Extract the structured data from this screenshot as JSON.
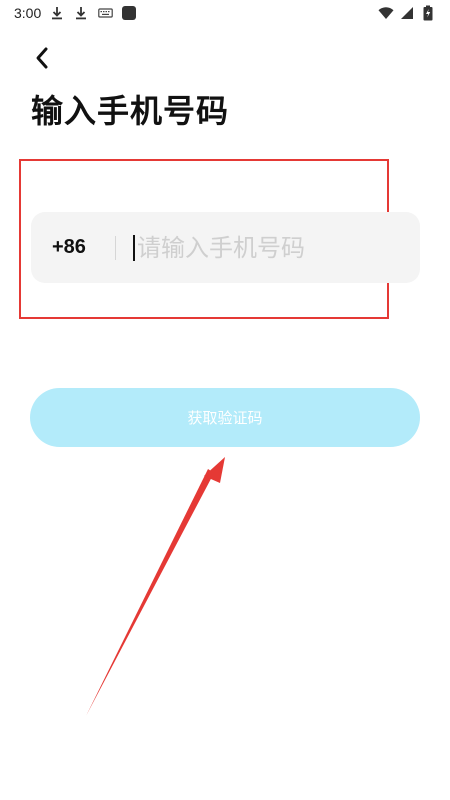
{
  "status_bar": {
    "time": "3:00",
    "left_icons": [
      "download-icon",
      "download-icon",
      "keyboard-icon",
      "app-icon"
    ],
    "right_icons": [
      "wifi-icon",
      "signal-icon",
      "battery-charging-icon"
    ]
  },
  "header": {
    "back_icon": "chevron-left-icon",
    "title": "输入手机号码"
  },
  "phone_input": {
    "country_code": "+86",
    "value": "",
    "placeholder": "请输入手机号码"
  },
  "actions": {
    "get_code_label": "获取验证码"
  },
  "colors": {
    "highlight": "#e53935",
    "button_bg": "#b3ebfa",
    "input_bg": "#f4f4f4",
    "arrow": "#e53935"
  }
}
